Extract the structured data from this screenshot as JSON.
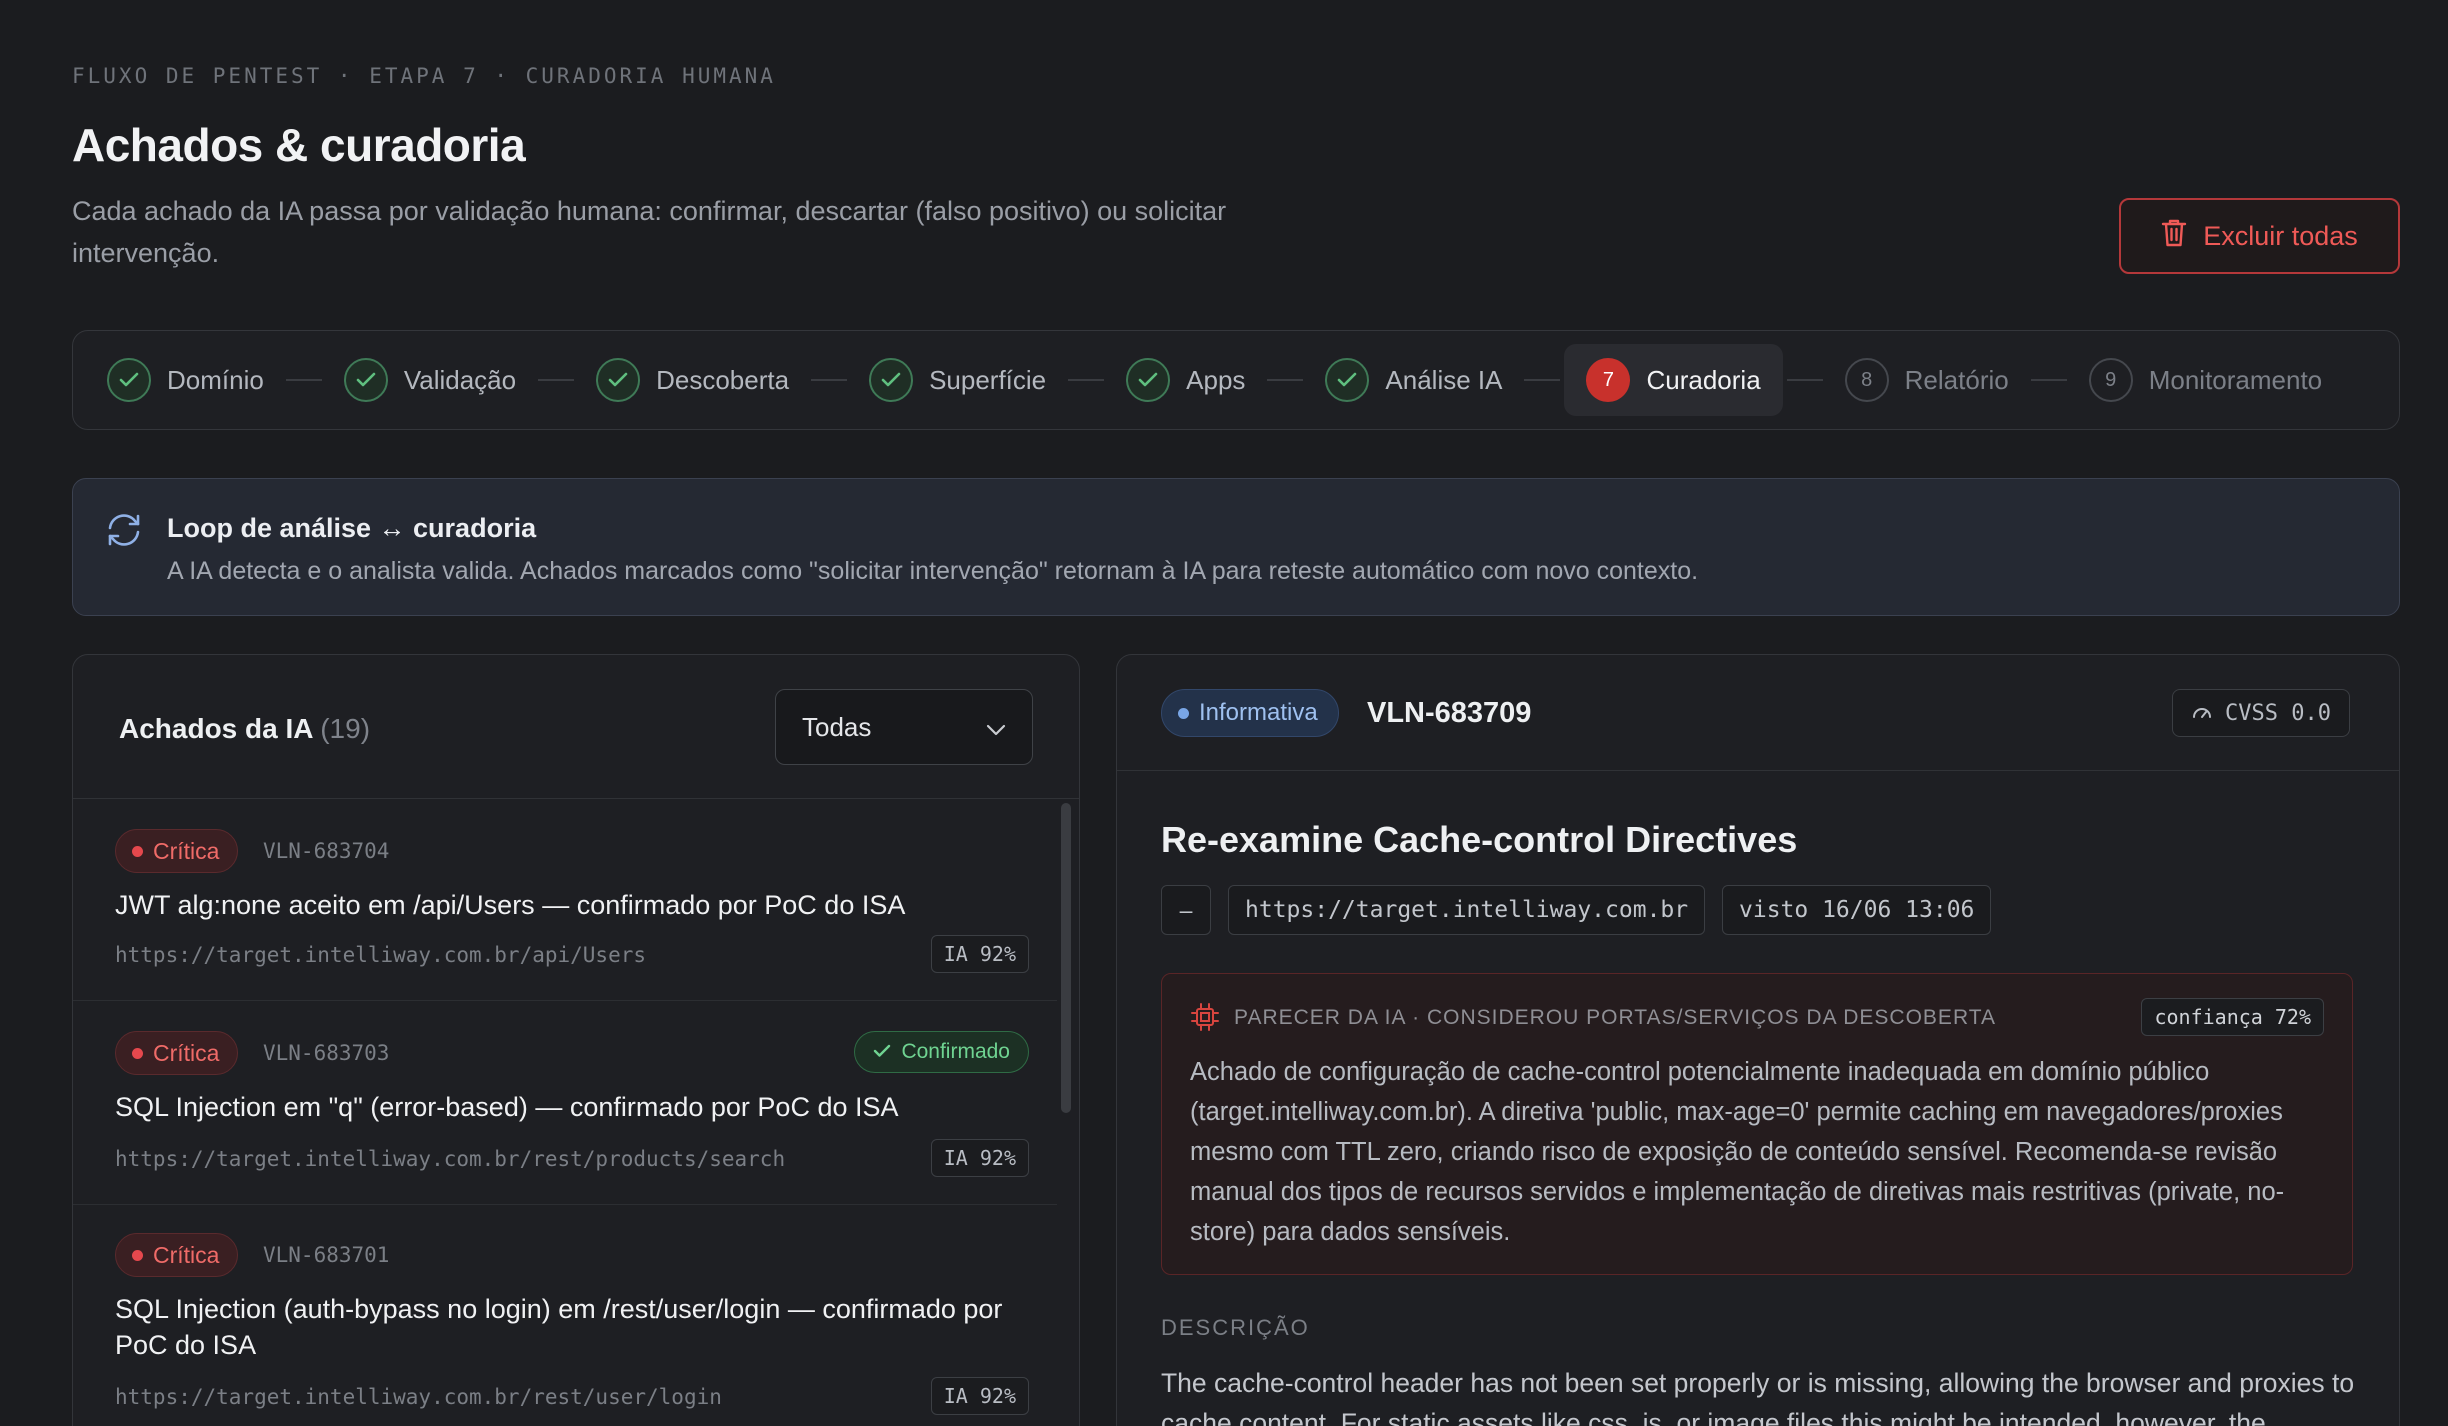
{
  "header": {
    "eyebrow": "FLUXO DE PENTEST · ETAPA 7 · CURADORIA HUMANA",
    "title": "Achados & curadoria",
    "subtitle": "Cada achado da IA passa por validação humana: confirmar, descartar (falso positivo) ou solicitar intervenção.",
    "delete_all_label": "Excluir todas"
  },
  "stepper": {
    "steps": [
      {
        "label": "Domínio",
        "state": "done"
      },
      {
        "label": "Validação",
        "state": "done"
      },
      {
        "label": "Descoberta",
        "state": "done"
      },
      {
        "label": "Superfície",
        "state": "done"
      },
      {
        "label": "Apps",
        "state": "done"
      },
      {
        "label": "Análise IA",
        "state": "done"
      },
      {
        "label": "Curadoria",
        "state": "active",
        "number": "7"
      },
      {
        "label": "Relatório",
        "state": "pending",
        "number": "8"
      },
      {
        "label": "Monitoramento",
        "state": "pending",
        "number": "9"
      }
    ]
  },
  "loop_banner": {
    "title": "Loop de análise ↔ curadoria",
    "description": "A IA detecta e o analista valida. Achados marcados como \"solicitar intervenção\" retornam à IA para reteste automático com novo contexto."
  },
  "findings_panel": {
    "title": "Achados da IA",
    "count": "(19)",
    "filter_value": "Todas",
    "items": [
      {
        "severity": "Crítica",
        "id": "VLN-683704",
        "title": "JWT alg:none aceito em /api/Users — confirmado por PoC do ISA",
        "url": "https://target.intelliway.com.br/api/Users",
        "ia": "IA 92%",
        "status": ""
      },
      {
        "severity": "Crítica",
        "id": "VLN-683703",
        "title": "SQL Injection em \"q\" (error-based) — confirmado por PoC do ISA",
        "url": "https://target.intelliway.com.br/rest/products/search",
        "ia": "IA 92%",
        "status": "Confirmado"
      },
      {
        "severity": "Crítica",
        "id": "VLN-683701",
        "title": "SQL Injection (auth-bypass no login) em /rest/user/login — confirmado por PoC do ISA",
        "url": "https://target.intelliway.com.br/rest/user/login",
        "ia": "IA 92%",
        "status": ""
      }
    ]
  },
  "detail": {
    "severity": "Informativa",
    "id": "VLN-683709",
    "cvss": "CVSS 0.0",
    "title": "Re-examine Cache-control Directives",
    "chips": {
      "dash": "–",
      "url": "https://target.intelliway.com.br",
      "seen": "visto 16/06 13:06"
    },
    "ai_opinion": {
      "label": "PARECER DA IA · CONSIDEROU PORTAS/SERVIÇOS DA DESCOBERTA",
      "confidence": "confiança 72%",
      "text": "Achado de configuração de cache-control potencialmente inadequada em domínio público (target.intelliway.com.br). A diretiva 'public, max-age=0' permite caching em navegadores/proxies mesmo com TTL zero, criando risco de exposição de conteúdo sensível. Recomenda-se revisão manual dos tipos de recursos servidos e implementação de diretivas mais restritivas (private, no-store) para dados sensíveis."
    },
    "description_label": "DESCRIÇÃO",
    "description": "The cache-control header has not been set properly or is missing, allowing the browser and proxies to cache content. For static assets like css, js, or image files this might be intended, however, the resources should be reviewed to ensure that no sensitive content will be cached."
  },
  "colors": {
    "background": "#1b1c1f",
    "critical": "#e5484d",
    "info": "#79a6e6",
    "active_step": "#c8312c",
    "confirmed": "#6fd391"
  }
}
